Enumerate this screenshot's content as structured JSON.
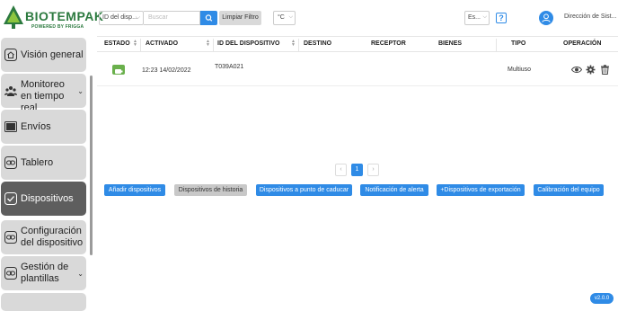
{
  "header": {
    "logo": {
      "name": "BIOTEMPAK",
      "tagline": "POWERED BY FRIGGA"
    },
    "filter_field": "ID del disp...",
    "search_placeholder": "Buscar",
    "clear_label": "Limpiar Filtro",
    "unit": "°C",
    "language": "Es...",
    "help_glyph": "?",
    "company": "Dirección de Sist...",
    "colors": {
      "brand": "#2c7a3f",
      "accent": "#2f8be6"
    }
  },
  "sidebar": {
    "items": [
      {
        "label": "Visión general",
        "icon": "home-icon",
        "active": false
      },
      {
        "label": "Monitoreo en tiempo real",
        "icon": "group-icon",
        "active": false,
        "expandable": true
      },
      {
        "label": "Envíos",
        "icon": "folder-icon",
        "active": false
      },
      {
        "label": "Tablero",
        "icon": "link-icon",
        "active": false
      },
      {
        "label": "Dispositivos",
        "icon": "check-icon",
        "active": true
      },
      {
        "label": "Configuración del dispositivo",
        "icon": "link-icon",
        "active": false
      },
      {
        "label": "Gestión de plantillas",
        "icon": "link-icon",
        "active": false,
        "expandable": true
      }
    ]
  },
  "table": {
    "columns": [
      "ESTADO",
      "ACTIVADO",
      "ID DEL DISPOSITIVO",
      "DESTINO",
      "RECEPTOR",
      "BIENES",
      "TIPO",
      "OPERACIÓN"
    ],
    "rows": [
      {
        "status": "online",
        "activated": "12:23 14/02/2022",
        "device_id": "T039A021",
        "destination": "",
        "receiver": "",
        "goods": "",
        "type": "Multiuso",
        "operations": [
          "eye-icon",
          "gear-icon",
          "trash-icon"
        ]
      }
    ]
  },
  "pagination": {
    "prev": "‹",
    "current": "1",
    "next": "›"
  },
  "actions": [
    "Añadir dispositivos",
    "Dispositivos de historia",
    "Dispositivos a punto de caducar",
    "Notificación de alerta",
    "+Dispositivos de exportación",
    "Calibración del equipo"
  ],
  "version": "v2.0.0"
}
